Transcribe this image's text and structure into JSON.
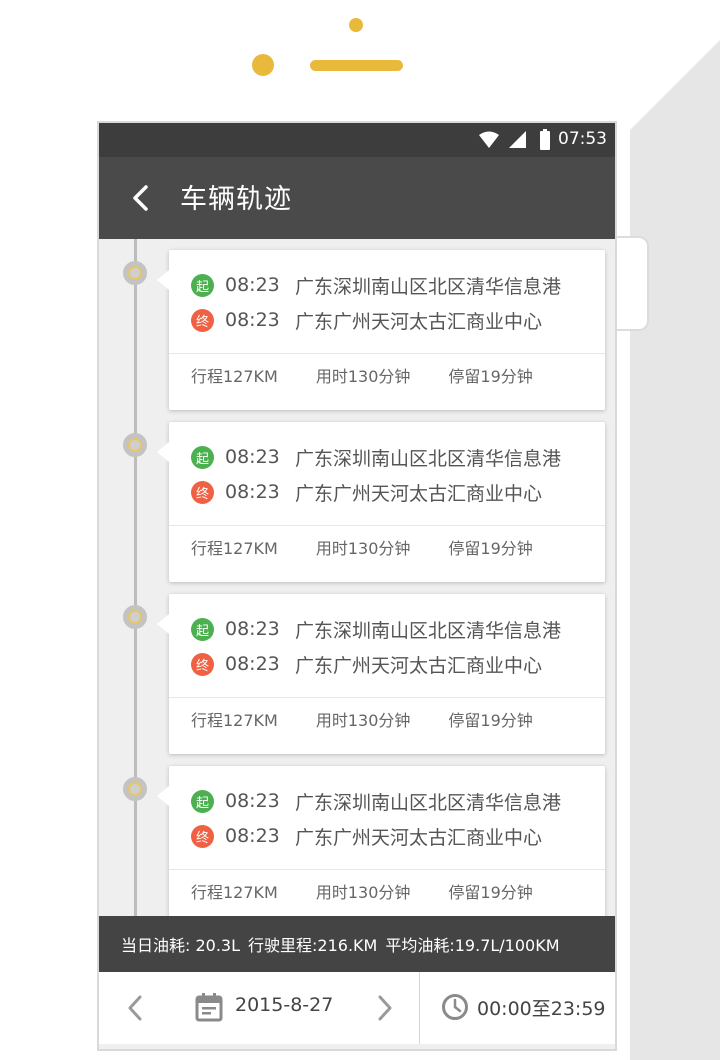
{
  "status_bar": {
    "time": "07:53"
  },
  "app_bar": {
    "title": "车辆轨迹"
  },
  "trips": [
    {
      "start": {
        "badge": "起",
        "time": "08:23",
        "place": "广东深圳南山区北区清华信息港"
      },
      "end": {
        "badge": "终",
        "time": "08:23",
        "place": "广东广州天河太古汇商业中心"
      },
      "distance": "行程127KM",
      "duration": "用时130分钟",
      "stay": "停留19分钟"
    },
    {
      "start": {
        "badge": "起",
        "time": "08:23",
        "place": "广东深圳南山区北区清华信息港"
      },
      "end": {
        "badge": "终",
        "time": "08:23",
        "place": "广东广州天河太古汇商业中心"
      },
      "distance": "行程127KM",
      "duration": "用时130分钟",
      "stay": "停留19分钟"
    },
    {
      "start": {
        "badge": "起",
        "time": "08:23",
        "place": "广东深圳南山区北区清华信息港"
      },
      "end": {
        "badge": "终",
        "time": "08:23",
        "place": "广东广州天河太古汇商业中心"
      },
      "distance": "行程127KM",
      "duration": "用时130分钟",
      "stay": "停留19分钟"
    },
    {
      "start": {
        "badge": "起",
        "time": "08:23",
        "place": "广东深圳南山区北区清华信息港"
      },
      "end": {
        "badge": "终",
        "time": "08:23",
        "place": "广东广州天河太古汇商业中心"
      },
      "distance": "行程127KM",
      "duration": "用时130分钟",
      "stay": "停留19分钟"
    }
  ],
  "summary": {
    "fuel": "当日油耗: 20.3L",
    "mileage": "行驶里程:216.KM",
    "avg_fuel": "平均油耗:19.7L/100KM"
  },
  "bottom_bar": {
    "date": "2015-8-27",
    "time_range": "00:00至23:59"
  },
  "colors": {
    "accent": "#e8b93a",
    "start_badge": "#4caf50",
    "end_badge": "#f06043",
    "app_bar": "#4a4a4a"
  },
  "icons": [
    "wifi-icon",
    "signal-icon",
    "battery-icon",
    "back-icon",
    "prev-icon",
    "calendar-icon",
    "next-icon",
    "clock-icon"
  ]
}
